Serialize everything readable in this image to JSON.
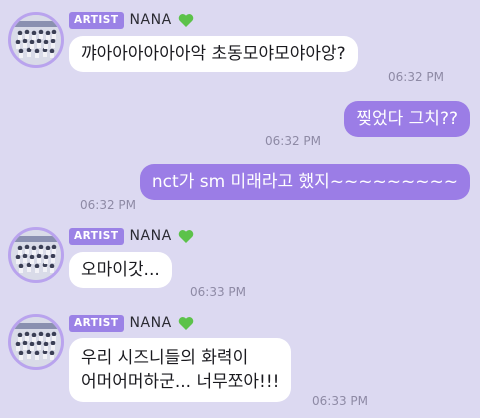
{
  "colors": {
    "background": "#dcd9f1",
    "artist_badge": "#9b82e6",
    "outgoing_bubble": "#9b7de6",
    "incoming_bubble": "#ffffff",
    "heart": "#5cc24a"
  },
  "messages": [
    {
      "direction": "incoming",
      "badge": "ARTIST",
      "sender": "NANA",
      "icon": "green-heart-icon",
      "text": "꺄아아아아아아악 초동모야모야아앙?",
      "time": "06:32 PM"
    },
    {
      "direction": "outgoing",
      "text": "찢었다 그치??",
      "time": "06:32 PM"
    },
    {
      "direction": "outgoing",
      "text": "nct가 sm 미래라고 했지~~~~~~~~~",
      "time": "06:32 PM"
    },
    {
      "direction": "incoming",
      "badge": "ARTIST",
      "sender": "NANA",
      "icon": "green-heart-icon",
      "text": "오마이갓...",
      "time": "06:33 PM"
    },
    {
      "direction": "incoming",
      "badge": "ARTIST",
      "sender": "NANA",
      "icon": "green-heart-icon",
      "text_lines": [
        "우리 시즈니들의 화력이",
        "어머어머하군... 너무쪼아!!!"
      ],
      "time": "06:33 PM"
    }
  ]
}
